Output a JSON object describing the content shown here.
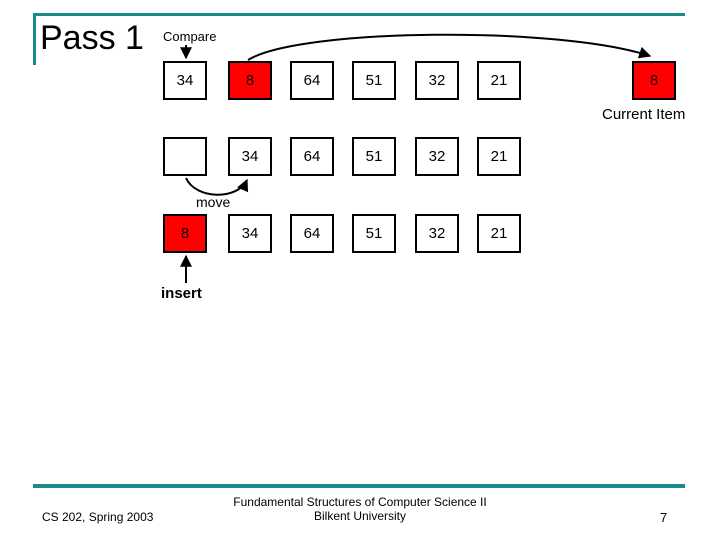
{
  "slide": {
    "title": "Pass 1",
    "accent_color": "#1b8a8c",
    "highlight_color": "#ff0000",
    "box_border_color": "#000000"
  },
  "labels": {
    "compare": "Compare",
    "current_item": "Current Item",
    "move": "move",
    "insert": "insert"
  },
  "rows": [
    {
      "name": "row-initial",
      "cells": [
        {
          "value": "34",
          "highlighted": false
        },
        {
          "value": "8",
          "highlighted": true
        },
        {
          "value": "64",
          "highlighted": false
        },
        {
          "value": "51",
          "highlighted": false
        },
        {
          "value": "32",
          "highlighted": false
        },
        {
          "value": "21",
          "highlighted": false
        }
      ],
      "current_item": {
        "value": "8",
        "highlighted": true
      }
    },
    {
      "name": "row-shifted",
      "cells": [
        {
          "value": "",
          "highlighted": false
        },
        {
          "value": "34",
          "highlighted": false
        },
        {
          "value": "64",
          "highlighted": false
        },
        {
          "value": "51",
          "highlighted": false
        },
        {
          "value": "32",
          "highlighted": false
        },
        {
          "value": "21",
          "highlighted": false
        }
      ]
    },
    {
      "name": "row-inserted",
      "cells": [
        {
          "value": "8",
          "highlighted": true
        },
        {
          "value": "34",
          "highlighted": false
        },
        {
          "value": "64",
          "highlighted": false
        },
        {
          "value": "51",
          "highlighted": false
        },
        {
          "value": "32",
          "highlighted": false
        },
        {
          "value": "21",
          "highlighted": false
        }
      ]
    }
  ],
  "footer": {
    "left": "CS 202, Spring 2003",
    "course_line1": "Fundamental Structures of Computer Science II",
    "course_line2": "Bilkent University",
    "page": "7"
  }
}
